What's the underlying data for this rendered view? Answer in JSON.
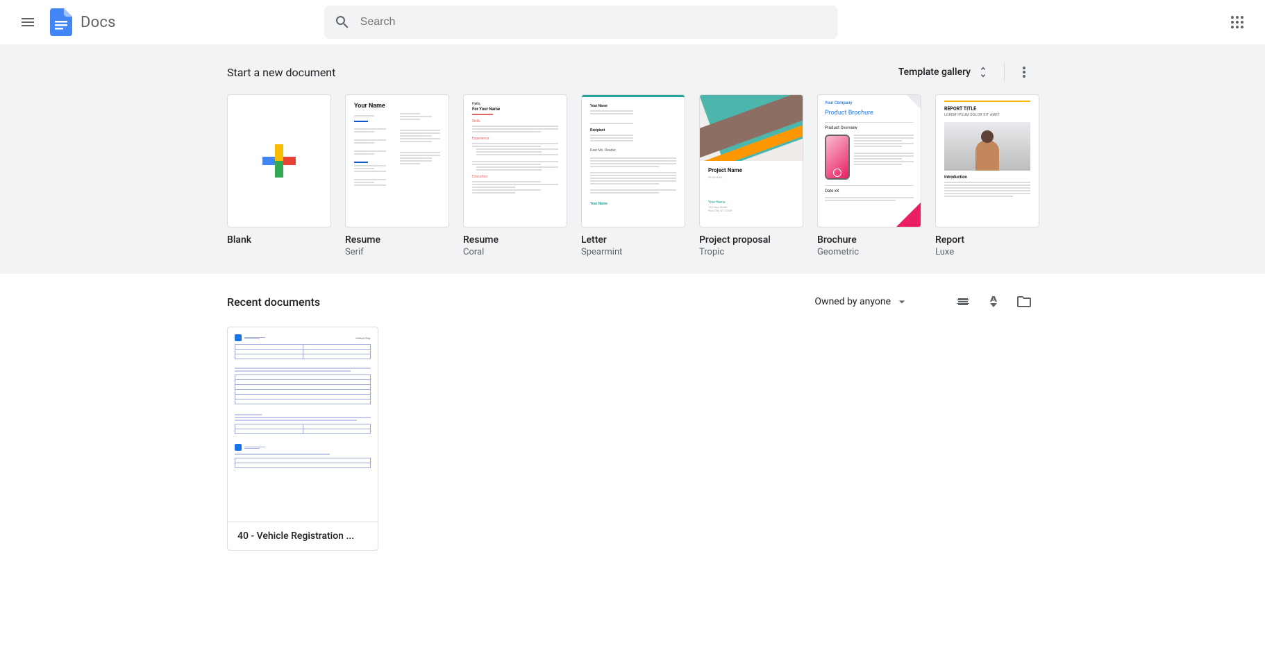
{
  "header": {
    "app_title": "Docs",
    "search_placeholder": "Search"
  },
  "templates": {
    "section_title": "Start a new document",
    "gallery_label": "Template gallery",
    "items": [
      {
        "title": "Blank",
        "subtitle": ""
      },
      {
        "title": "Resume",
        "subtitle": "Serif"
      },
      {
        "title": "Resume",
        "subtitle": "Coral"
      },
      {
        "title": "Letter",
        "subtitle": "Spearmint"
      },
      {
        "title": "Project proposal",
        "subtitle": "Tropic"
      },
      {
        "title": "Brochure",
        "subtitle": "Geometric"
      },
      {
        "title": "Report",
        "subtitle": "Luxe"
      }
    ],
    "mini": {
      "serif_name": "Your Name",
      "coral_first": "For Your Name",
      "coral_skills": "Skills",
      "coral_exp": "Experience",
      "coral_edu": "Education",
      "spearmint_from": "Your Name",
      "spearmint_sal": "Dear Ms. Reader,",
      "tropic_name": "Project Name",
      "tropic_meta": "Your Name",
      "geo_company": "Your Company",
      "geo_title": "Product Brochure",
      "geo_overview": "Product Overview",
      "geo_date": "Date xX",
      "luxe_title": "REPORT TITLE",
      "luxe_sub": "LOREM IPSUM DOLOR SIT AMET",
      "luxe_intro": "Introduction"
    }
  },
  "recent": {
    "section_title": "Recent documents",
    "owned_label": "Owned by anyone",
    "docs": [
      {
        "title": "40 - Vehicle Registration ..."
      }
    ]
  }
}
